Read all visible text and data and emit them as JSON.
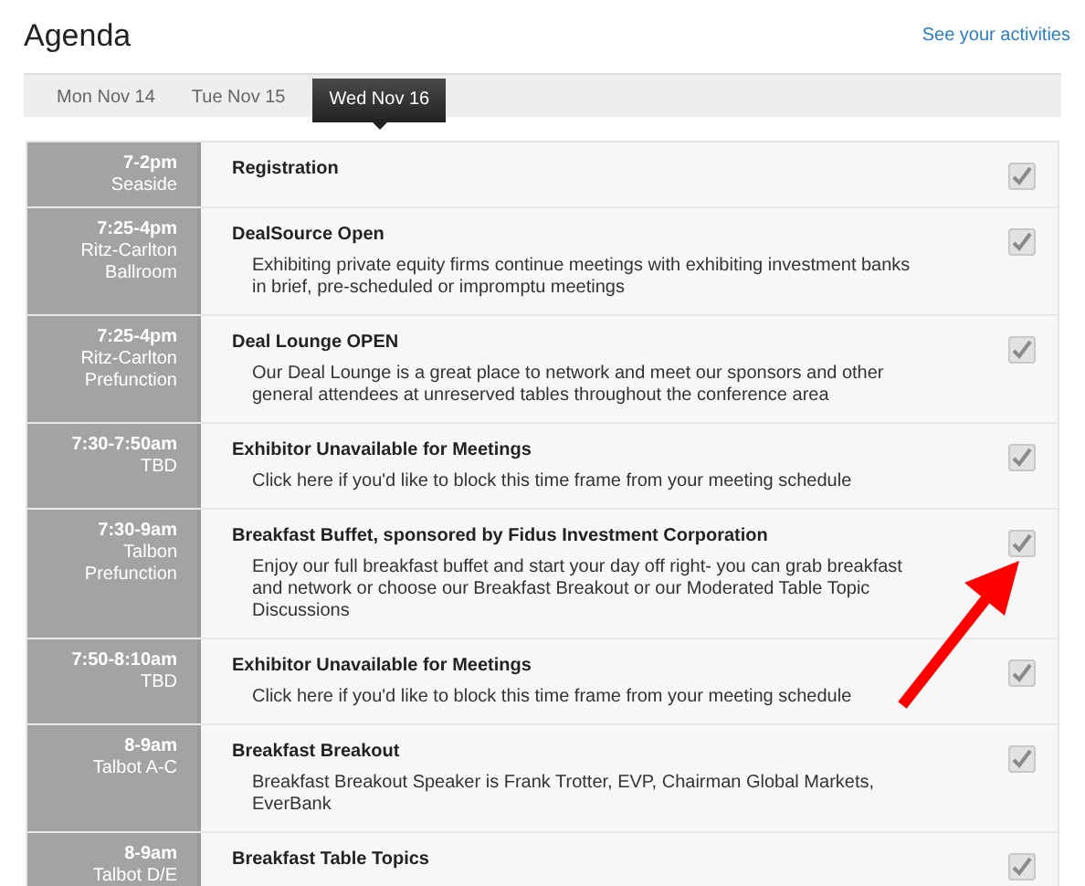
{
  "title": "Agenda",
  "activities_link": "See your activities",
  "tabs": [
    {
      "label": "Mon Nov 14",
      "selected": false
    },
    {
      "label": "Tue Nov 15",
      "selected": false
    },
    {
      "label": "Wed Nov 16",
      "selected": true
    }
  ],
  "sessions": [
    {
      "time": "7-2pm",
      "location": "Seaside",
      "title": "Registration",
      "checked": true
    },
    {
      "time": "7:25-4pm",
      "location": "Ritz-Carlton Ballroom",
      "title": "DealSource Open",
      "description": "Exhibiting private equity firms continue meetings with exhibiting investment banks in brief, pre-scheduled or impromptu meetings",
      "checked": true
    },
    {
      "time": "7:25-4pm",
      "location": "Ritz-Carlton Prefunction",
      "title": "Deal Lounge OPEN",
      "description": "Our Deal Lounge is a great place to network and meet our sponsors and other general attendees at unreserved tables throughout the conference area",
      "checked": true
    },
    {
      "time": "7:30-7:50am",
      "location": "TBD",
      "title": "Exhibitor Unavailable for Meetings",
      "description": "Click here if you'd like to block this time frame from your meeting schedule",
      "checked": true
    },
    {
      "time": "7:30-9am",
      "location": "Talbon Prefunction",
      "title": "Breakfast Buffet, sponsored by Fidus Investment Corporation",
      "description": "Enjoy our full breakfast buffet and start your day off right- you can grab breakfast and network or choose our Breakfast Breakout or our Moderated Table Topic Discussions",
      "checked": true
    },
    {
      "time": "7:50-8:10am",
      "location": "TBD",
      "title": "Exhibitor Unavailable for Meetings",
      "description": "Click here if you'd like to block this time frame from your meeting schedule",
      "checked": true
    },
    {
      "time": "8-9am",
      "location": "Talbot A-C",
      "title": "Breakfast Breakout",
      "description": "Breakfast Breakout Speaker is Frank Trotter, EVP, Chairman Global Markets, EverBank",
      "checked": true
    },
    {
      "time": "8-9am",
      "location": "Talbot D/E",
      "title": "Breakfast Table Topics",
      "checked": true
    }
  ]
}
